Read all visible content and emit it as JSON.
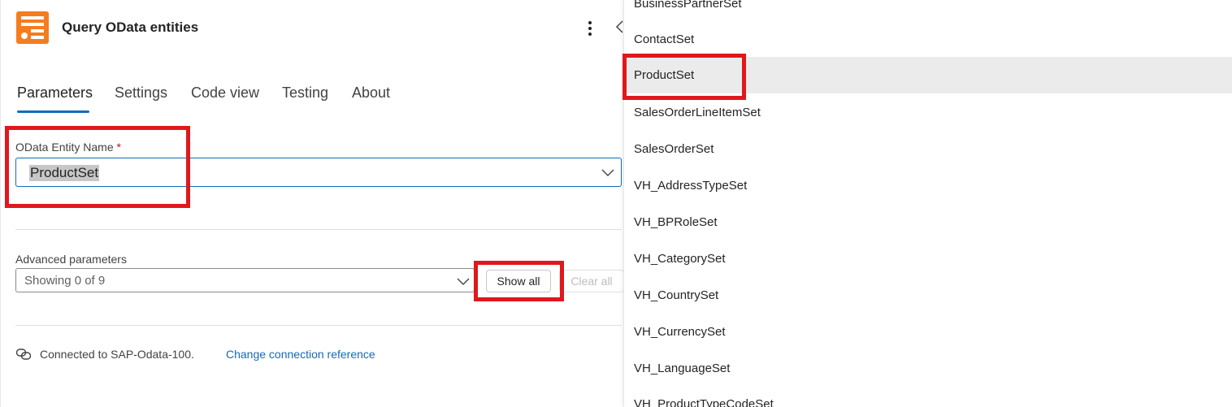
{
  "header": {
    "title": "Query OData entities",
    "icon": "table-list-icon",
    "accent_color": "#f57c1f"
  },
  "tabs": [
    {
      "label": "Parameters",
      "active": true
    },
    {
      "label": "Settings",
      "active": false
    },
    {
      "label": "Code view",
      "active": false
    },
    {
      "label": "Testing",
      "active": false
    },
    {
      "label": "About",
      "active": false
    }
  ],
  "entity_field": {
    "label": "OData Entity Name",
    "required_marker": "*",
    "value": "ProductSet"
  },
  "advanced": {
    "label": "Advanced parameters",
    "value": "Showing 0 of 9",
    "show_all_label": "Show all",
    "clear_all_label": "Clear all"
  },
  "connection": {
    "text": "Connected to SAP-Odata-100.",
    "link": "Change connection reference"
  },
  "dropdown": {
    "items": [
      "BusinessPartnerSet",
      "ContactSet",
      "ProductSet",
      "SalesOrderLineItemSet",
      "SalesOrderSet",
      "VH_AddressTypeSet",
      "VH_BPRoleSet",
      "VH_CategorySet",
      "VH_CountrySet",
      "VH_CurrencySet",
      "VH_LanguageSet",
      "VH_ProductTypeCodeSet"
    ],
    "selected": "ProductSet"
  },
  "colors": {
    "primary": "#0f6cbd",
    "highlight": "#e0181c",
    "required": "#c50f1f"
  }
}
